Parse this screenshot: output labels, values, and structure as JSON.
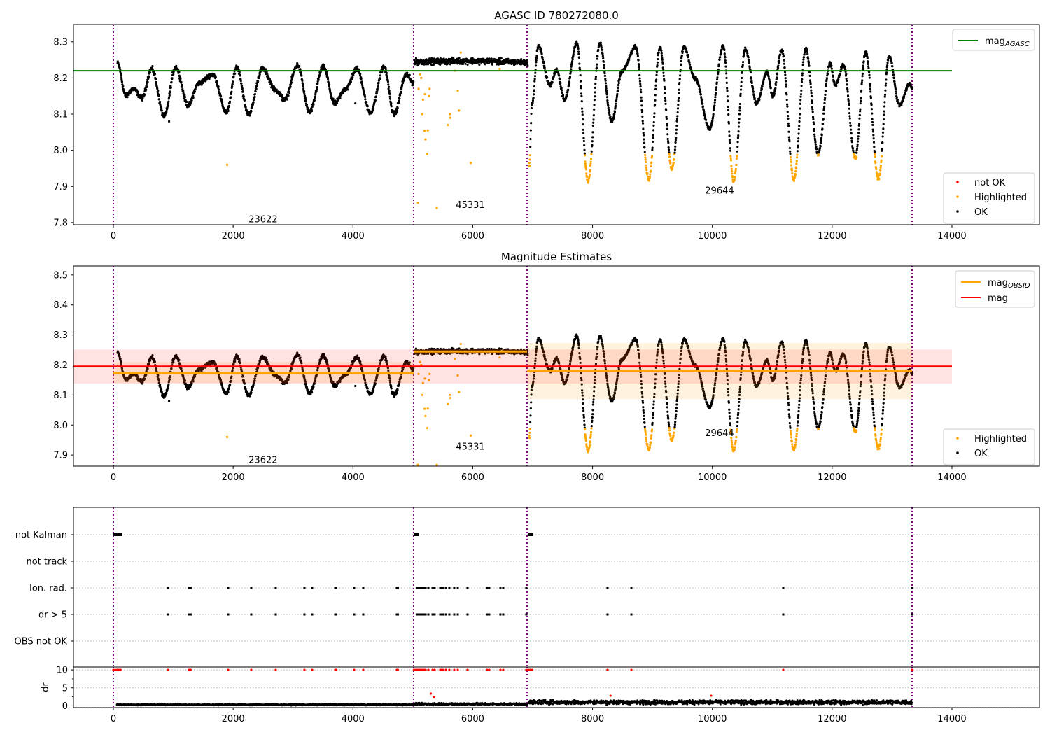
{
  "chart_data": [
    {
      "type": "scatter",
      "title": "AGASC ID 780272080.0",
      "xlim": [
        -666,
        15461
      ],
      "ylim": [
        7.794,
        8.348
      ],
      "xticks": [
        0,
        2000,
        4000,
        6000,
        8000,
        10000,
        12000,
        14000
      ],
      "yticks": [
        7.8,
        7.9,
        8.0,
        8.1,
        8.2,
        8.3
      ],
      "ytick_labels": [
        "7.8",
        "7.9",
        "8.0",
        "8.1",
        "8.2",
        "8.3"
      ],
      "grid": false,
      "obsid_boundaries": [
        0,
        5013,
        6906,
        13334
      ],
      "obsid_labels": [
        {
          "text": "23622",
          "x": 2500,
          "y": 7.81
        },
        {
          "text": "45331",
          "x": 5960,
          "y": 7.85
        },
        {
          "text": "29644",
          "x": 10120,
          "y": 7.89
        }
      ],
      "mag_agasc": 8.22,
      "legend_lines": {
        "position": "top-right",
        "items": [
          {
            "label": "mag",
            "sub": "AGASC",
            "color": "#008000"
          }
        ]
      },
      "legend_points": {
        "position": "bottom-right",
        "items": [
          {
            "label": "not OK",
            "color": "#ff0000"
          },
          {
            "label": "Highlighted",
            "color": "#ffa500"
          },
          {
            "label": "OK",
            "color": "#000000"
          }
        ]
      },
      "series": {
        "ok_segments": [
          {
            "noise": 0.01,
            "points": [
              [
                70,
                8.24
              ],
              [
                210,
                8.15
              ],
              [
                330,
                8.17
              ],
              [
                480,
                8.145
              ],
              [
                640,
                8.225
              ],
              [
                850,
                8.095
              ],
              [
                1040,
                8.23
              ],
              [
                1250,
                8.125
              ],
              [
                1425,
                8.185
              ],
              [
                1660,
                8.21
              ],
              [
                1890,
                8.105
              ],
              [
                2060,
                8.23
              ],
              [
                2255,
                8.1
              ],
              [
                2490,
                8.225
              ],
              [
                2720,
                8.165
              ],
              [
                2860,
                8.14
              ],
              [
                3075,
                8.235
              ],
              [
                3275,
                8.105
              ],
              [
                3505,
                8.23
              ],
              [
                3695,
                8.13
              ],
              [
                3880,
                8.17
              ],
              [
                4065,
                8.225
              ],
              [
                4290,
                8.105
              ],
              [
                4520,
                8.23
              ],
              [
                4685,
                8.1
              ],
              [
                4895,
                8.21
              ],
              [
                5010,
                8.185
              ]
            ]
          },
          {
            "noise": 0.012,
            "points": [
              [
                5030,
                8.245
              ],
              [
                6000,
                8.247
              ],
              [
                6920,
                8.243
              ]
            ]
          },
          {
            "noise": 0.008,
            "points": [
              [
                6945,
                7.96
              ],
              [
                6990,
                8.13
              ],
              [
                7095,
                8.287
              ],
              [
                7290,
                8.18
              ],
              [
                7400,
                8.222
              ],
              [
                7535,
                8.14
              ],
              [
                7735,
                8.295
              ],
              [
                7925,
                7.915
              ],
              [
                8120,
                8.295
              ],
              [
                8320,
                8.08
              ],
              [
                8495,
                8.22
              ],
              [
                8720,
                8.285
              ],
              [
                8940,
                7.92
              ],
              [
                9125,
                8.285
              ],
              [
                9325,
                7.95
              ],
              [
                9525,
                8.285
              ],
              [
                9710,
                8.2
              ],
              [
                9955,
                8.06
              ],
              [
                10180,
                8.287
              ],
              [
                10355,
                7.915
              ],
              [
                10550,
                8.28
              ],
              [
                10740,
                8.13
              ],
              [
                10915,
                8.215
              ],
              [
                11010,
                8.15
              ],
              [
                11160,
                8.277
              ],
              [
                11360,
                7.92
              ],
              [
                11560,
                8.28
              ],
              [
                11765,
                7.99
              ],
              [
                11965,
                8.24
              ],
              [
                12050,
                8.18
              ],
              [
                12190,
                8.235
              ],
              [
                12385,
                7.98
              ],
              [
                12560,
                8.27
              ],
              [
                12775,
                7.92
              ],
              [
                12950,
                8.26
              ],
              [
                13125,
                8.125
              ],
              [
                13300,
                8.185
              ],
              [
                13340,
                8.17
              ]
            ]
          }
        ],
        "highlight_below": 7.99,
        "ok_outliers": [
          [
            930,
            8.08
          ],
          [
            4040,
            8.13
          ]
        ],
        "highlighted_outliers": [
          [
            1900,
            7.96
          ],
          [
            5085,
            7.855
          ],
          [
            5095,
            8.17
          ],
          [
            5120,
            8.21
          ],
          [
            5140,
            8.2
          ],
          [
            5160,
            8.1
          ],
          [
            5170,
            8.14
          ],
          [
            5195,
            8.054
          ],
          [
            5200,
            8.155
          ],
          [
            5210,
            8.03
          ],
          [
            5240,
            7.99
          ],
          [
            5250,
            8.055
          ],
          [
            5270,
            8.15
          ],
          [
            5280,
            8.17
          ],
          [
            5400,
            7.84
          ],
          [
            5585,
            8.07
          ],
          [
            5620,
            8.1
          ],
          [
            5625,
            8.09
          ],
          [
            5700,
            8.22
          ],
          [
            5750,
            8.165
          ],
          [
            5770,
            8.11
          ],
          [
            5970,
            7.965
          ],
          [
            6450,
            8.225
          ],
          [
            5800,
            8.27
          ]
        ]
      }
    },
    {
      "type": "scatter",
      "title": "Magnitude Estimates",
      "xlim": [
        -666,
        15461
      ],
      "ylim": [
        7.863,
        8.53
      ],
      "xticks": [
        0,
        2000,
        4000,
        6000,
        8000,
        10000,
        12000,
        14000
      ],
      "yticks": [
        7.9,
        8.0,
        8.1,
        8.2,
        8.3,
        8.4,
        8.5
      ],
      "ytick_labels": [
        "7.9",
        "8.0",
        "8.1",
        "8.2",
        "8.3",
        "8.4",
        "8.5"
      ],
      "grid": false,
      "obsid_labels": [
        {
          "text": "23622",
          "x": 2500,
          "y": 7.885
        },
        {
          "text": "45331",
          "x": 5960,
          "y": 7.93
        },
        {
          "text": "29644",
          "x": 10120,
          "y": 7.975
        }
      ],
      "mag": {
        "value": 8.196,
        "band": [
          8.138,
          8.252
        ],
        "color": "#ff0000"
      },
      "mag_obsid": [
        {
          "start": 0,
          "end": 5013,
          "value": 8.173,
          "band": [
            8.14,
            8.21
          ]
        },
        {
          "start": 5013,
          "end": 6906,
          "value": 8.245,
          "band": [
            8.235,
            8.255
          ]
        },
        {
          "start": 6906,
          "end": 13334,
          "value": 8.18,
          "band": [
            8.086,
            8.273
          ]
        }
      ],
      "legend_lines": {
        "position": "top-right",
        "items": [
          {
            "label": "mag",
            "sub": "OBSID",
            "color": "#ffa500"
          },
          {
            "label": "mag",
            "sub": "",
            "color": "#ff0000"
          }
        ]
      },
      "legend_points": {
        "position": "bottom-right",
        "items": [
          {
            "label": "Highlighted",
            "color": "#ffa500"
          },
          {
            "label": "OK",
            "color": "#000000"
          }
        ]
      }
    },
    {
      "type": "scatter",
      "xlim": [
        -666,
        15461
      ],
      "xticks": [
        0,
        2000,
        4000,
        6000,
        8000,
        10000,
        12000,
        14000
      ],
      "categories": [
        "not Kalman",
        "not track",
        "Ion. rad.",
        "dr > 5",
        "OBS not OK"
      ],
      "grid": true,
      "not_kalman_ranges": [
        [
          0,
          150
        ],
        [
          5020,
          5100
        ],
        [
          6930,
          7010
        ]
      ],
      "flag_events_x": [
        912,
        1262,
        1290,
        1917,
        2302,
        2711,
        3190,
        3319,
        3705,
        3720,
        4020,
        4172,
        4733,
        4750,
        5072,
        5095,
        5118,
        5140,
        5165,
        5190,
        5212,
        5259,
        5329,
        5364,
        5457,
        5480,
        5504,
        5551,
        5609,
        5691,
        5750,
        5913,
        6240,
        6275,
        6462,
        6509,
        6895,
        8250,
        8648,
        11184,
        13334
      ],
      "dr": {
        "ylabel": "dr",
        "ylim": [
          -0.5,
          10.8
        ],
        "yticks": [
          0,
          5,
          10
        ],
        "ytick_labels": [
          "0",
          "5",
          "10"
        ],
        "level_by_segment": [
          [
            60,
            5013,
            0.3
          ],
          [
            5030,
            6906,
            0.5
          ],
          [
            6930,
            13334,
            1.0
          ]
        ],
        "flagged_value": 10,
        "flagged_extra": [
          [
            5300,
            3.4
          ],
          [
            5350,
            2.5
          ],
          [
            8300,
            2.8
          ],
          [
            9980,
            2.8
          ]
        ]
      }
    }
  ]
}
